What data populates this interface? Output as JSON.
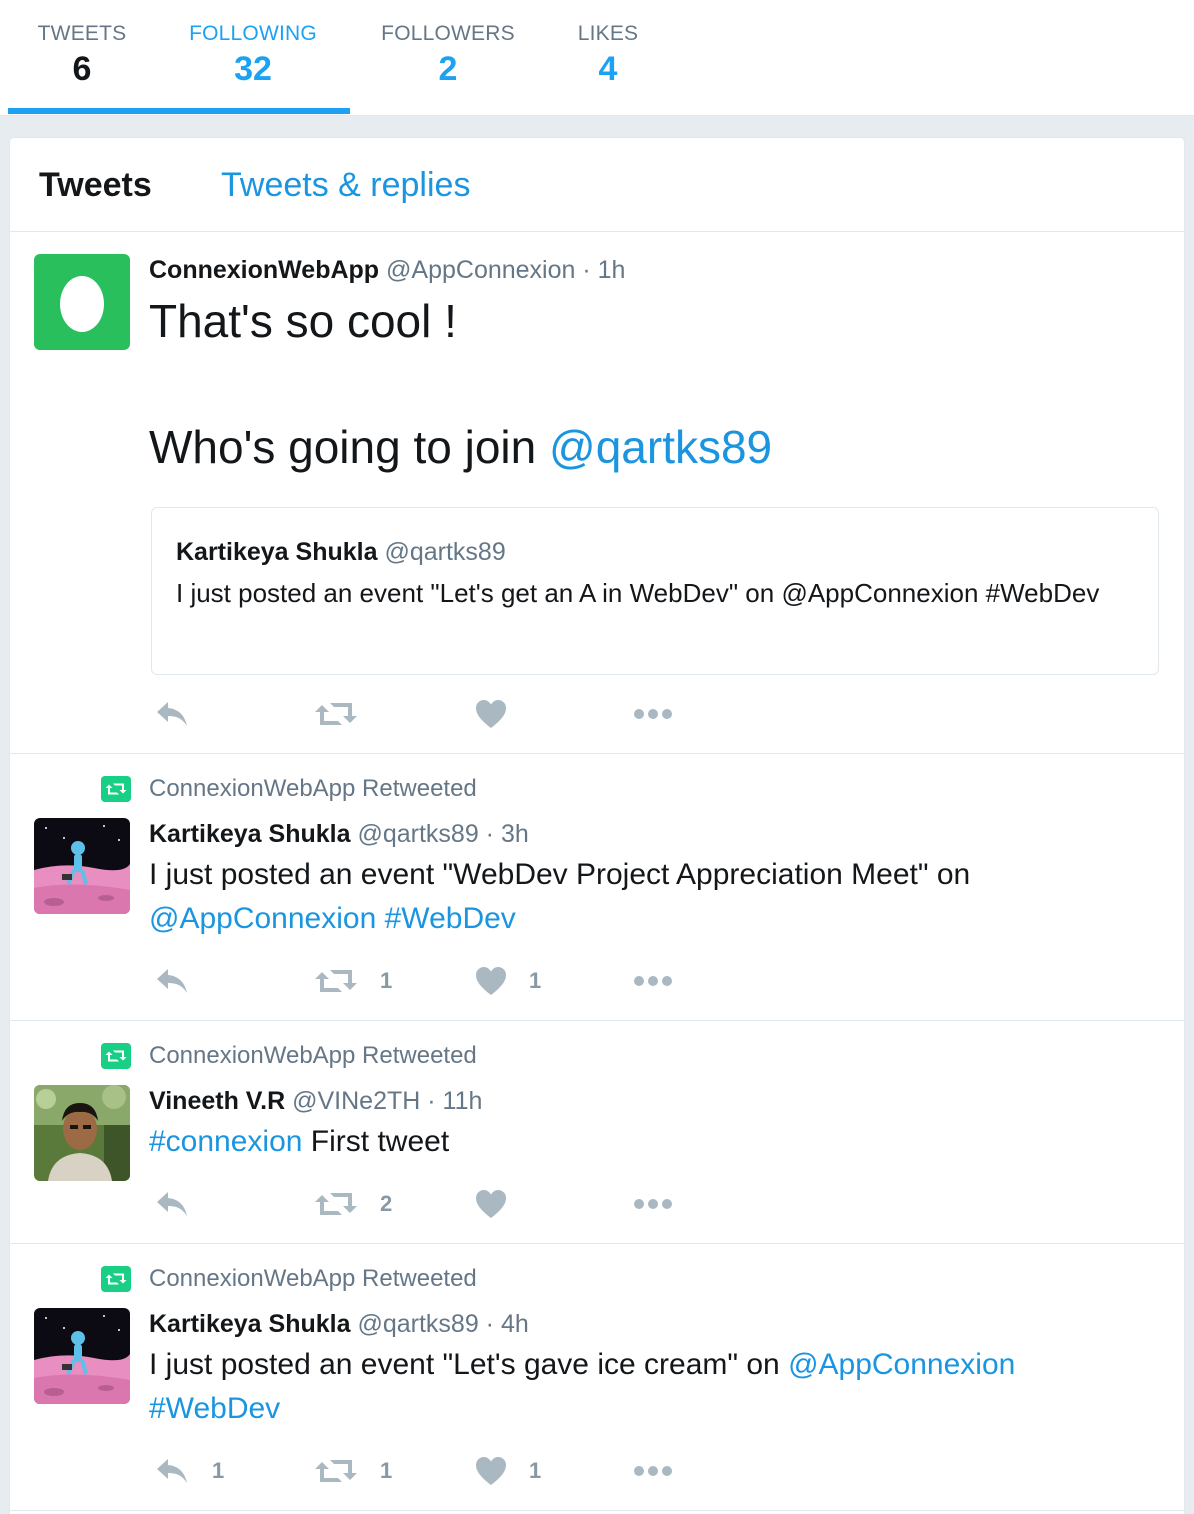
{
  "stats": {
    "tweets": {
      "label": "TWEETS",
      "value": "6"
    },
    "following": {
      "label": "FOLLOWING",
      "value": "32"
    },
    "followers": {
      "label": "FOLLOWERS",
      "value": "2"
    },
    "likes": {
      "label": "LIKES",
      "value": "4"
    }
  },
  "tabs": {
    "tweets": "Tweets",
    "replies": "Tweets & replies"
  },
  "colors": {
    "accent": "#1da1f2",
    "link": "#1b95e0",
    "retweet": "#19cf86",
    "muted": "#657786",
    "icon": "#aab8c2"
  },
  "tweets": [
    {
      "fullname": "ConnexionWebApp",
      "username": "@AppConnexion",
      "sep": " · ",
      "time": "1h",
      "line1": "That's so cool !",
      "line2": "Who's going to join ",
      "line2_link": "@qartks89",
      "quote": {
        "fullname": "Kartikeya Shukla",
        "username": "@qartks89",
        "text": "I just posted an event \"Let's get an A in WebDev\"  on @AppConnexion #WebDev"
      },
      "avatar_icon": "egg-icon"
    },
    {
      "context": "ConnexionWebApp Retweeted",
      "fullname": "Kartikeya Shukla",
      "username": "@qartks89",
      "sep": " · ",
      "time": "3h",
      "text": "I just posted an event \"WebDev Project Appreciation Meet\"  on ",
      "link1": "@AppConnexion",
      "link2": "#WebDev",
      "retweets": "1",
      "likes": "1"
    },
    {
      "context": "ConnexionWebApp Retweeted",
      "fullname": "Vineeth V.R",
      "username": "@VINe2TH",
      "sep": " · ",
      "time": "11h",
      "link1": "#connexion",
      "text": " First tweet",
      "retweets": "2"
    },
    {
      "context": "ConnexionWebApp Retweeted",
      "fullname": "Kartikeya Shukla",
      "username": "@qartks89",
      "sep": " · ",
      "time": "4h",
      "text": "I just posted an event \"Let's gave ice cream\"  on ",
      "link1": "@AppConnexion",
      "link2": "#WebDev",
      "replies": "1",
      "retweets": "1",
      "likes": "1"
    }
  ]
}
